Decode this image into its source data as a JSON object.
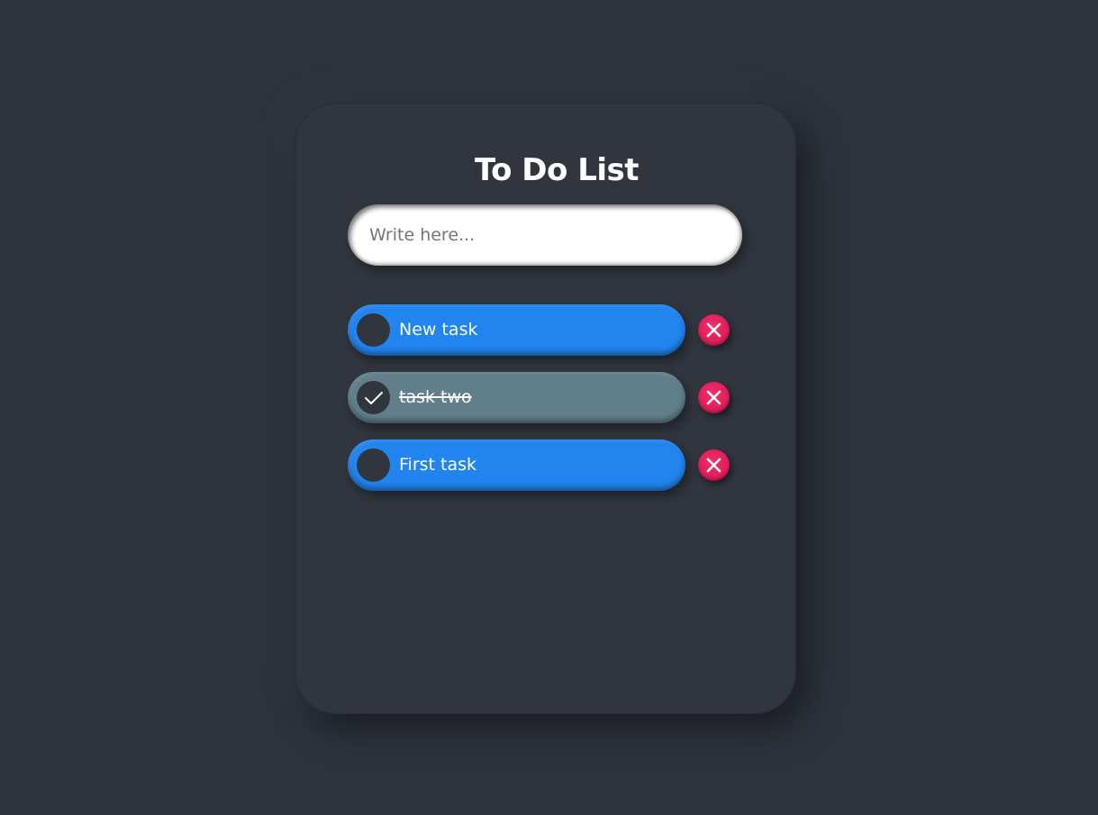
{
  "app": {
    "title": "To Do List"
  },
  "input": {
    "placeholder": "Write here...",
    "value": ""
  },
  "tasks": [
    {
      "label": "New task",
      "completed": false,
      "status_color": "#2284ee"
    },
    {
      "label": "task two",
      "completed": true,
      "status_color": "#617f8a"
    },
    {
      "label": "First task",
      "completed": false,
      "status_color": "#2284ee"
    }
  ],
  "icons": {
    "toggle": "circle-toggle-icon",
    "checked": "checkmark-icon",
    "delete": "close-icon"
  },
  "colors": {
    "background": "#2f343c",
    "card": "#30353e",
    "accent": "#2284ee",
    "completed": "#617f8a",
    "delete": "#e01e5a"
  }
}
